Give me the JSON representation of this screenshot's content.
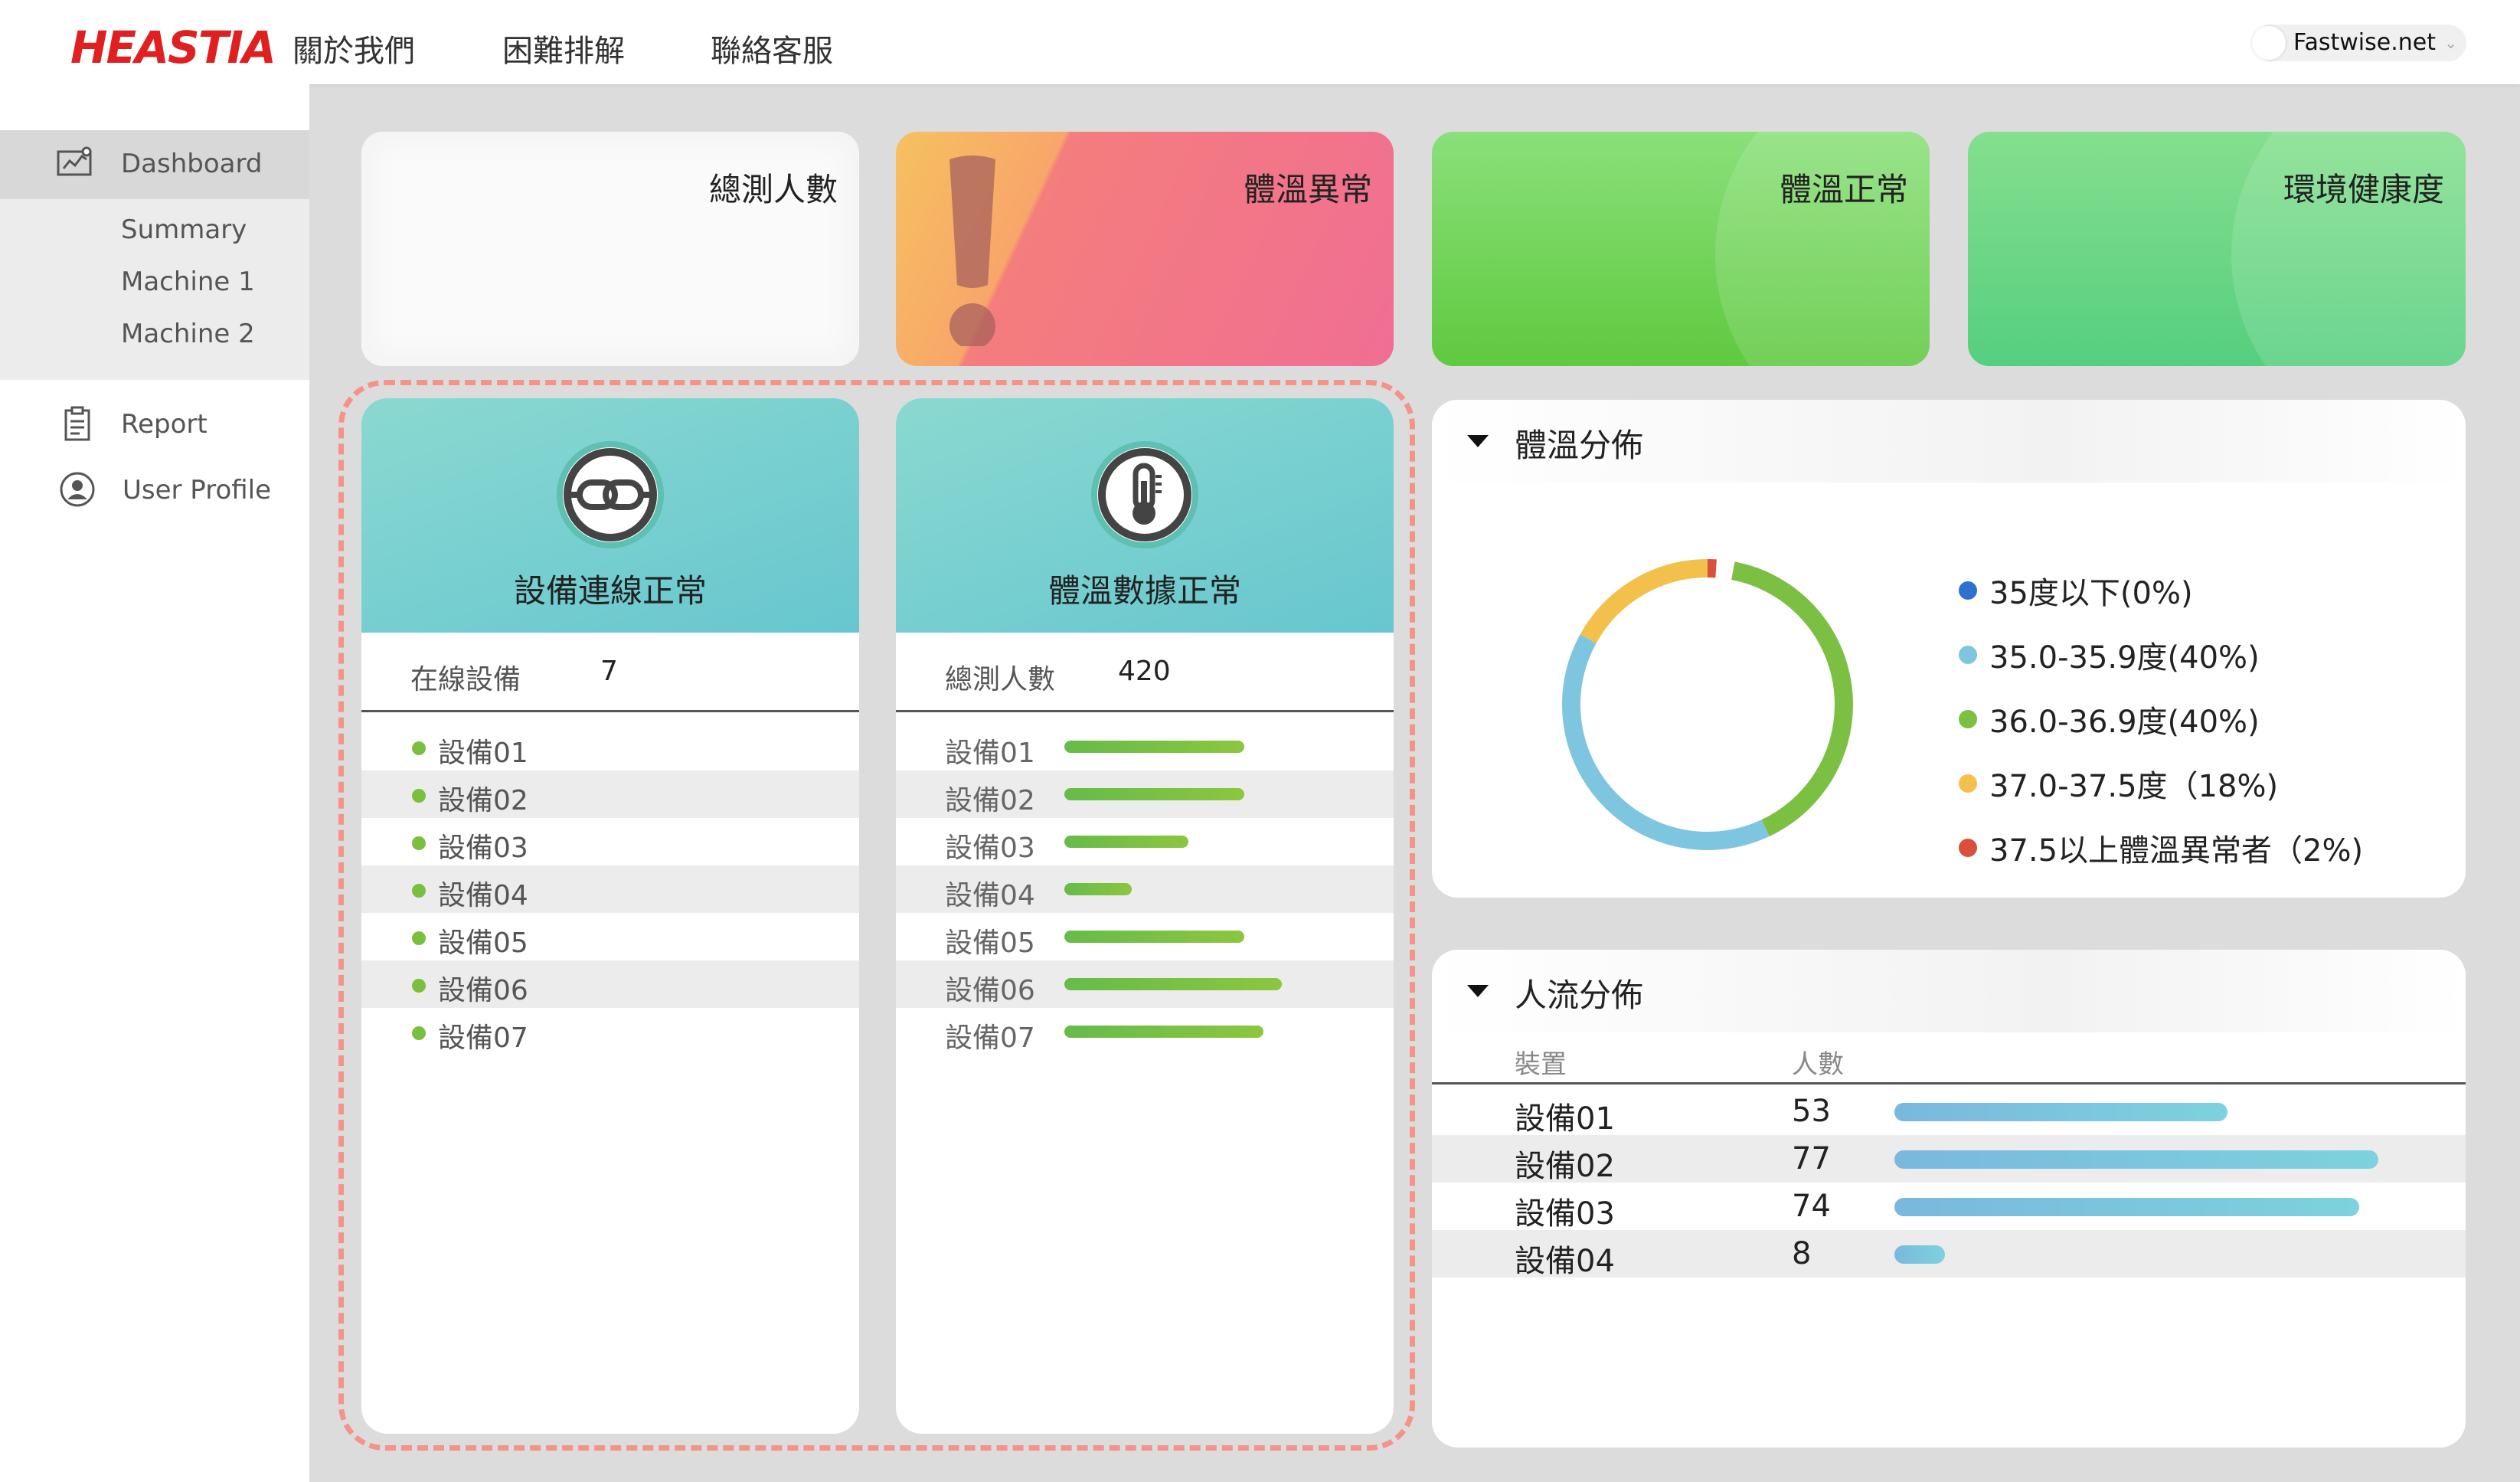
{
  "brand": {
    "logo": "HEASTIA"
  },
  "nav": [
    {
      "label": "關於我們"
    },
    {
      "label": "困難排解"
    },
    {
      "label": "聯絡客服"
    }
  ],
  "user": {
    "site": "Fastwise.net"
  },
  "sidebar": {
    "items": [
      {
        "label": "Dashboard",
        "icon": "chart-icon"
      },
      {
        "label": "Summary"
      },
      {
        "label": "Machine 1"
      },
      {
        "label": "Machine 2"
      },
      {
        "label": "Report",
        "icon": "clipboard-icon"
      },
      {
        "label": "User Profile",
        "icon": "user-icon"
      }
    ]
  },
  "stats": {
    "total": "總測人數",
    "abnormal": "體溫異常",
    "normal": "體溫正常",
    "env": "環境健康度"
  },
  "connection": {
    "title": "設備連線正常",
    "summary_label": "在線設備",
    "summary_value": "7",
    "devices": [
      "設備01",
      "設備02",
      "設備03",
      "設備04",
      "設備05",
      "設備06",
      "設備07"
    ]
  },
  "temperature": {
    "title": "體溫數據正常",
    "summary_label": "總測人數",
    "summary_value": "420",
    "devices": [
      "設備01",
      "設備02",
      "設備03",
      "設備04",
      "設備05",
      "設備06",
      "設備07"
    ],
    "bar_fill": [
      0.48,
      0.48,
      0.33,
      0.18,
      0.48,
      0.58,
      0.53
    ]
  },
  "distribution": {
    "title": "體溫分佈",
    "legend": [
      {
        "label": "35度以下(0%)",
        "color": "#2f6fcf"
      },
      {
        "label": "35.0-35.9度(40%)",
        "color": "#7ec6e0"
      },
      {
        "label": "36.0-36.9度(40%)",
        "color": "#7bc043"
      },
      {
        "label": "37.0-37.5度（18%)",
        "color": "#f3c14b"
      },
      {
        "label": "37.5以上體溫異常者（2%)",
        "color": "#d9503f"
      }
    ]
  },
  "chart_data": {
    "type": "pie",
    "categories": [
      "35度以下",
      "35.0-35.9度",
      "36.0-36.9度",
      "37.0-37.5度",
      "37.5以上體溫異常者"
    ],
    "values": [
      0,
      40,
      40,
      18,
      2
    ],
    "colors": [
      "#2f6fcf",
      "#7ec6e0",
      "#7bc043",
      "#f3c14b",
      "#d9503f"
    ]
  },
  "flow": {
    "title": "人流分佈",
    "col_device": "裝置",
    "col_count": "人數",
    "rows": [
      {
        "device": "設備01",
        "count": "53",
        "value": 53
      },
      {
        "device": "設備02",
        "count": "77",
        "value": 77
      },
      {
        "device": "設備03",
        "count": "74",
        "value": 74
      },
      {
        "device": "設備04",
        "count": "8",
        "value": 8
      }
    ],
    "max": 77
  }
}
